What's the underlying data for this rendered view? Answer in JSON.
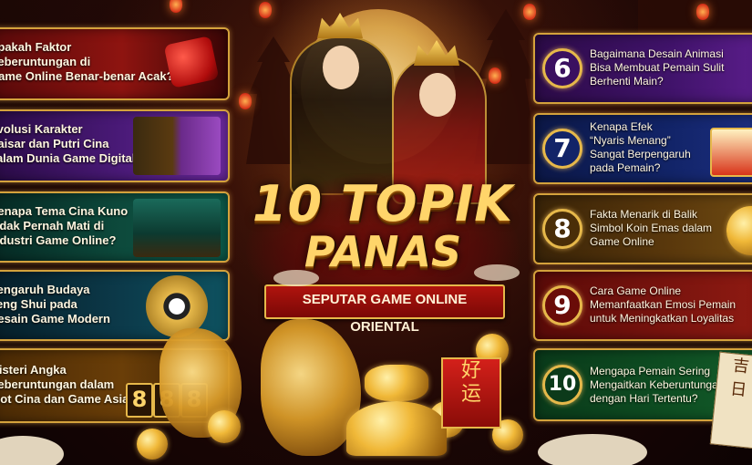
{
  "title": {
    "line1": "10 TOPIK",
    "line2": "PANAS",
    "ribbon": "SEPUTAR GAME ONLINE ORIENTAL"
  },
  "left_cards": [
    {
      "text": "Apakah Faktor\nKeberuntungan di\nGame Online Benar-benar Acak?"
    },
    {
      "text": "Evolusi Karakter\nKaisar dan Putri Cina\ndalam Dunia Game Digital"
    },
    {
      "text": "Kenapa Tema Cina Kuno\nTidak Pernah Mati di\nIndustri Game Online?"
    },
    {
      "text": "Pengaruh Budaya\nFeng Shui pada\nDesain Game Modern"
    },
    {
      "text": "Misteri Angka\nKeberuntungan dalam\nSlot Cina dan Game Asia"
    }
  ],
  "right_cards": [
    {
      "number": "6",
      "text": "Bagaimana Desain Animasi\nBisa Membuat Pemain Sulit\nBerhenti Main?"
    },
    {
      "number": "7",
      "text": "Kenapa Efek\n“Nyaris Menang”\nSangat Berpengaruh\npada Pemain?"
    },
    {
      "number": "8",
      "text": "Fakta Menarik di Balik\nSimbol Koin Emas dalam\nGame Online"
    },
    {
      "number": "9",
      "text": "Cara Game Online\nMemanfaatkan Emosi Pemain\nuntuk Meningkatkan Loyalitas"
    },
    {
      "number": "10",
      "text": "Mengapa Pemain Sering\nMengaitkan Keberuntungan\ndengan Hari Tertentu?"
    }
  ],
  "slot_digits": [
    "8",
    "8",
    "8"
  ],
  "banner_chars": "好\n运",
  "scroll_chars": "吉\n日",
  "colors": {
    "gold": "#e6b84a",
    "title": "#ffd56a",
    "ribbon": "#b0140e"
  }
}
